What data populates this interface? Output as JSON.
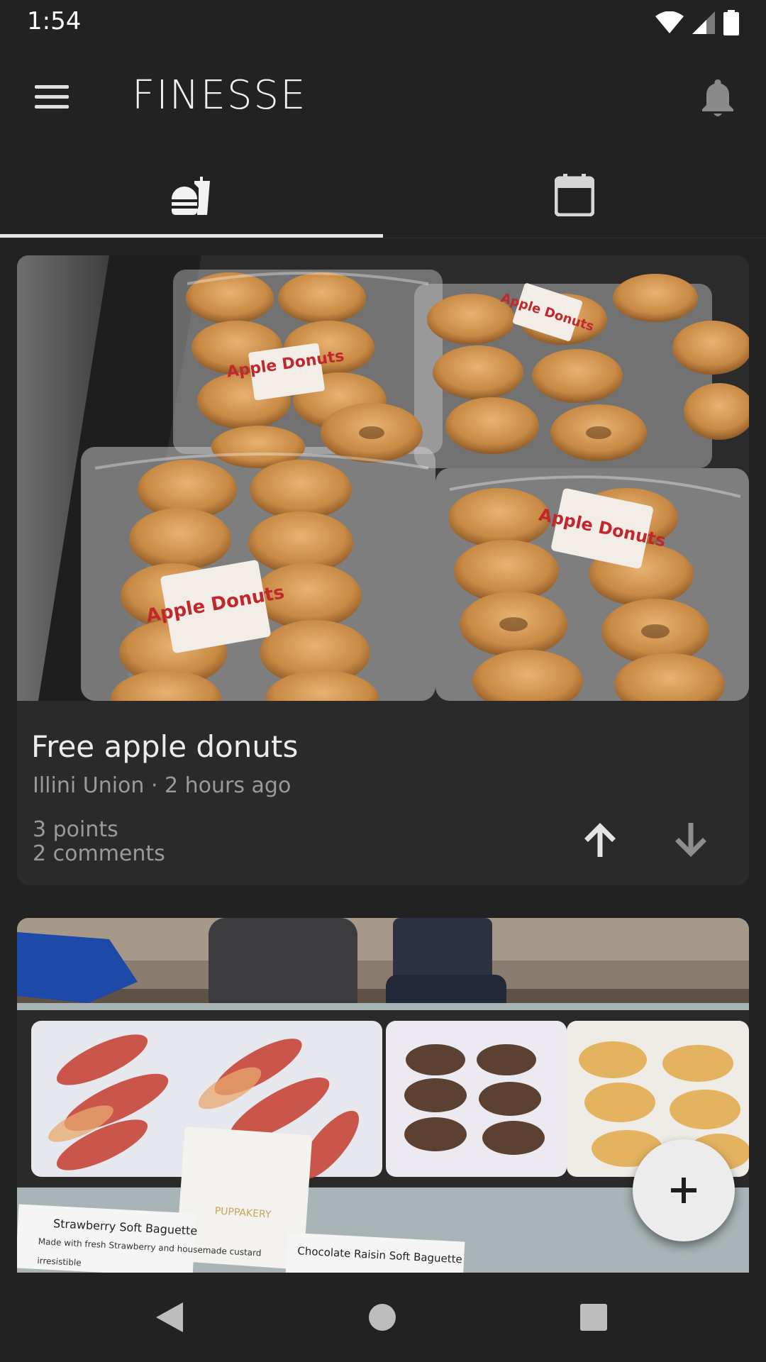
{
  "status_bar": {
    "time": "1:54",
    "icons": [
      "wifi-icon",
      "cell-signal-icon",
      "battery-icon"
    ]
  },
  "app_bar": {
    "title": "FINESSE",
    "menu_icon": "hamburger-menu-icon",
    "notifications_icon": "bell-icon"
  },
  "tabs": [
    {
      "icon": "fastfood-icon",
      "selected": true
    },
    {
      "icon": "calendar-icon",
      "selected": false
    }
  ],
  "posts": [
    {
      "image": "photo of boxed apple donuts",
      "image_labels": [
        "Apple Donuts",
        "Apple Donuts",
        "Apple Donuts",
        "Apple Donuts"
      ],
      "title": "Free apple donuts",
      "subtitle": "Illini Union · 2 hours ago",
      "points": "3 points",
      "comments": "2 comments",
      "upvote_icon": "arrow-up-icon",
      "downvote_icon": "arrow-down-icon"
    },
    {
      "image": "photo of pastry trays on a table",
      "image_labels": [
        "Strawberry Soft Baguette",
        "Made with fresh Strawberry and housemade custard",
        "irresistible",
        "PUPPAKERY",
        "Chocolate Raisin Soft Baguette"
      ]
    }
  ],
  "fab": {
    "icon": "plus-icon"
  },
  "nav_bar": {
    "icons": [
      "back-triangle-icon",
      "home-circle-icon",
      "recents-square-icon"
    ]
  },
  "colors": {
    "background": "#222222",
    "card": "#2a2a2a",
    "text_primary": "#ececec",
    "text_secondary": "#9a9a9a",
    "fab": "#ececec"
  }
}
